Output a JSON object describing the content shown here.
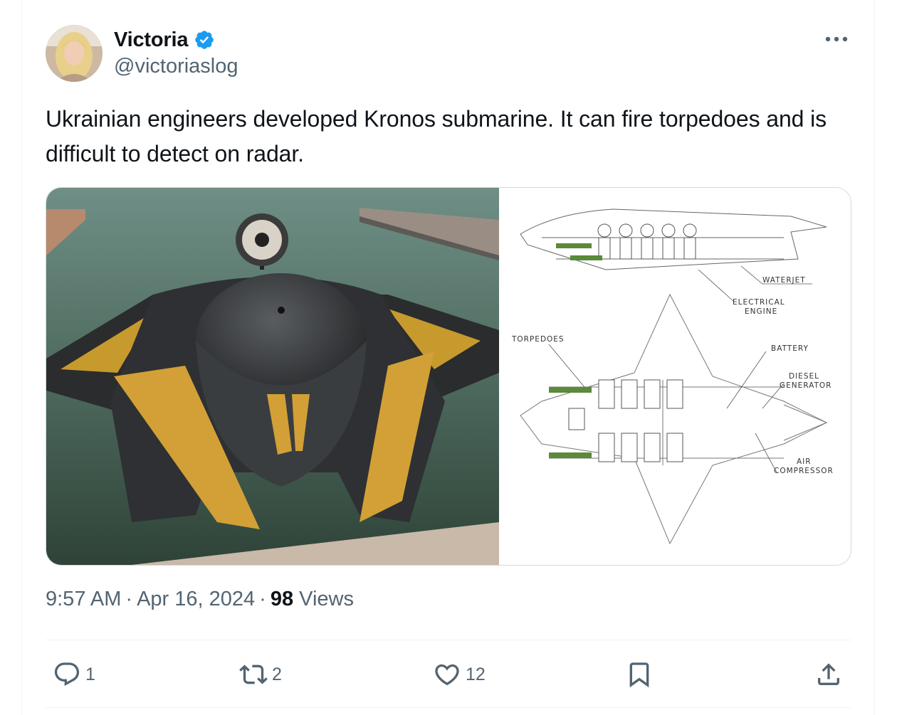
{
  "author": {
    "display_name": "Victoria",
    "handle": "@victoriaslog",
    "verified": true
  },
  "tweet": {
    "text": "Ukrainian engineers developed Kronos submarine. It can fire torpedoes and is difficult to detect on radar."
  },
  "media": {
    "diagram_labels": {
      "waterjet": "WATERJET",
      "electrical_1": "ELECTRICAL",
      "electrical_2": "ENGINE",
      "torpedoes": "TORPEDOES",
      "battery": "BATTERY",
      "diesel_1": "DIESEL",
      "diesel_2": "GENERATOR",
      "air_1": "AIR",
      "air_2": "COMPRESSOR"
    }
  },
  "meta": {
    "time": "9:57 AM",
    "separator": "·",
    "date": "Apr 16, 2024",
    "views_count": "98",
    "views_label": "Views"
  },
  "actions": {
    "replies": "1",
    "reposts": "2",
    "likes": "12"
  },
  "icons": {
    "verified": "verified-badge-icon",
    "more": "more-horizontal-icon",
    "reply": "reply-icon",
    "repost": "repost-icon",
    "like": "heart-icon",
    "bookmark": "bookmark-icon",
    "share": "share-icon"
  },
  "colors": {
    "text": "#0f1419",
    "secondary": "#536471",
    "verified_blue": "#1d9bf0",
    "border": "#cfd9de"
  }
}
